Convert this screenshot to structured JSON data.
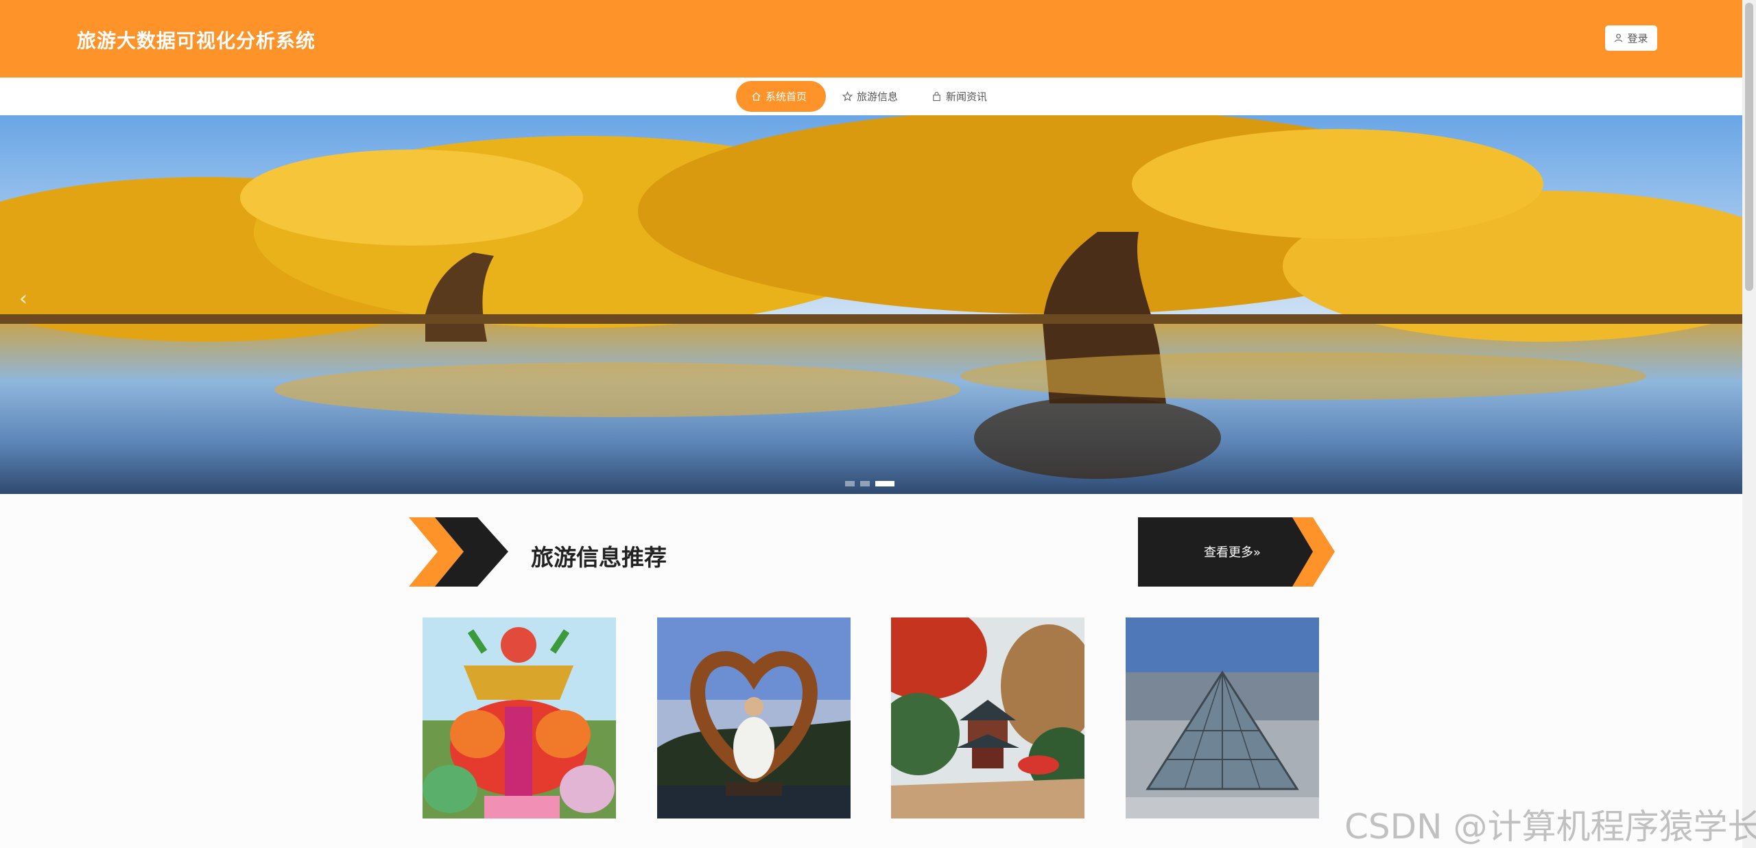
{
  "header": {
    "site_title": "旅游大数据可视化分析系统",
    "login_label": "登录"
  },
  "nav": {
    "items": [
      {
        "label": "系统首页",
        "icon": "home-icon",
        "active": true
      },
      {
        "label": "旅游信息",
        "icon": "star-icon",
        "active": false
      },
      {
        "label": "新闻资讯",
        "icon": "bag-icon",
        "active": false
      }
    ]
  },
  "banner": {
    "prev_label": "‹",
    "slide_count": 3,
    "active_slide": 3
  },
  "section": {
    "title": "旅游信息推荐",
    "more_label": "查看更多»"
  },
  "cards": [
    {
      "image": "lantern-festival"
    },
    {
      "image": "heart-frame-girl"
    },
    {
      "image": "pavilion-autumn"
    },
    {
      "image": "louvre-pyramid"
    }
  ],
  "watermark": "CSDN @计算机程序猿学长",
  "colors": {
    "accent": "#fe9329",
    "dark": "#1a1a1a"
  }
}
